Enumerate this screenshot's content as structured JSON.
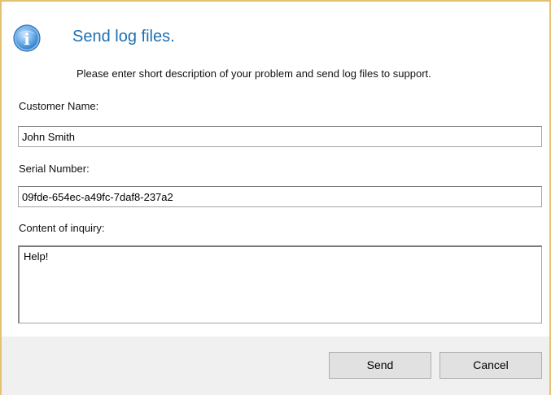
{
  "dialog": {
    "title": "Send log files.",
    "instruction": "Please enter short description of your problem and send log files to support."
  },
  "icon": {
    "name": "info-icon",
    "glyph": "i",
    "color": "#1f6fb2"
  },
  "fields": {
    "customer_name": {
      "label": "Customer Name:",
      "value": "John Smith"
    },
    "serial_number": {
      "label": "Serial Number:",
      "value": "09fde-654ec-a49fc-7daf8-237a2"
    },
    "inquiry": {
      "label": "Content of inquiry:",
      "value": "Help!"
    }
  },
  "buttons": {
    "send_label": "Send",
    "cancel_label": "Cancel"
  },
  "colors": {
    "title": "#1f6fb2",
    "frame": "#e3c171",
    "button_band": "#f0f0f0",
    "button_face": "#e1e1e1"
  }
}
